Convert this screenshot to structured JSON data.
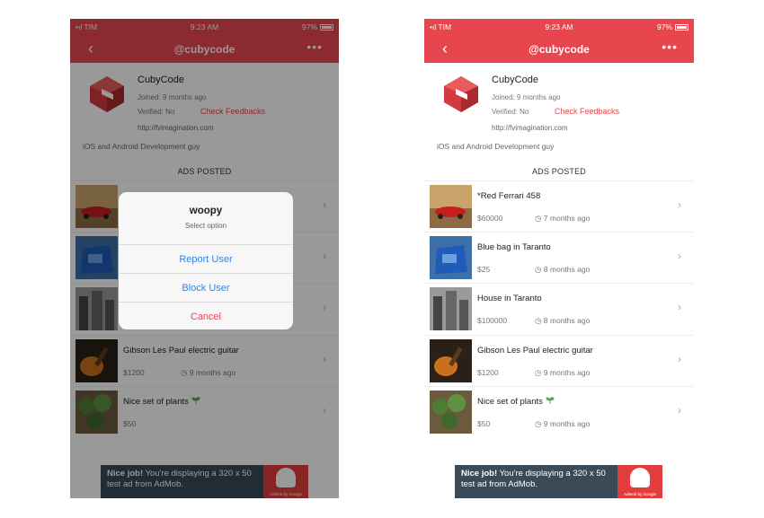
{
  "status_bar": {
    "carrier": "•ıl TIM",
    "time": "9:23 AM",
    "battery": "97%"
  },
  "nav": {
    "title": "@cubycode",
    "back_label": "‹",
    "more_label": "•••"
  },
  "profile": {
    "name": "CubyCode",
    "joined": "Joined: 9 months ago",
    "verified": "Verified: No",
    "feedback_link": "Check Feedbacks",
    "website": "http://fvimagination.com",
    "bio": "iOS and Android Development guy"
  },
  "ads_section_title": "ADS POSTED",
  "ads": [
    {
      "title": "*Red Ferrari 458",
      "price": "$60000",
      "time": "7 months ago"
    },
    {
      "title": "Blue bag in Taranto",
      "price": "$25",
      "time": "8 months ago"
    },
    {
      "title": "House in Taranto",
      "price": "$100000",
      "time": "8 months ago"
    },
    {
      "title": "Gibson Les Paul electric guitar",
      "price": "$1200",
      "time": "9 months ago"
    },
    {
      "title": "Nice set of plants",
      "price": "$50",
      "time": "9 months ago"
    }
  ],
  "banner": {
    "bold": "Nice job!",
    "text": " You're displaying a 320 x 50 test ad from AdMob.",
    "brand": "AdMob by Google"
  },
  "action_sheet": {
    "title": "woopy",
    "subtitle": "Select option",
    "report": "Report User",
    "block": "Block User",
    "cancel": "Cancel"
  },
  "colors": {
    "accent": "#e8464f",
    "ios_blue": "#2f87e6",
    "banner_bg": "#3a4a57"
  },
  "icons": {
    "back": "chevron-left-icon",
    "more": "ellipsis-icon",
    "row": "chevron-right-icon",
    "time": "clock-icon",
    "wifi": "wifi-icon",
    "battery": "battery-icon"
  }
}
